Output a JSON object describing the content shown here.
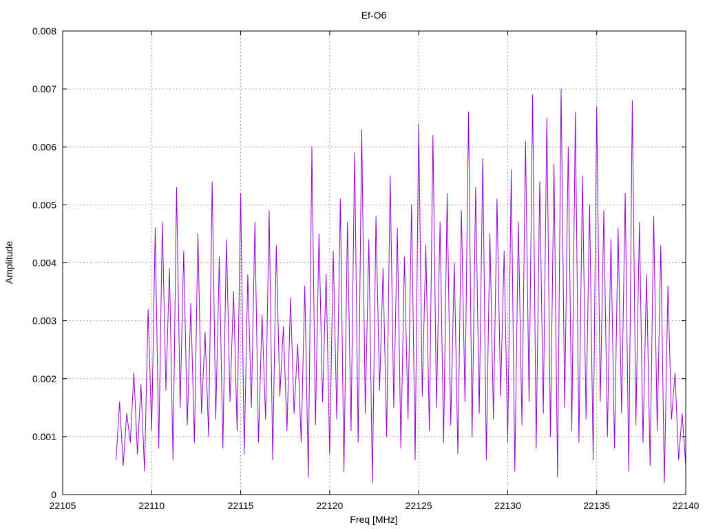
{
  "chart_data": {
    "type": "line",
    "title": "Ef-O6",
    "xlabel": "Freq [MHz]",
    "ylabel": "Amplitude",
    "xlim": [
      22105,
      22140
    ],
    "ylim": [
      0,
      0.008
    ],
    "x_ticks": [
      "22105",
      "22110",
      "22115",
      "22120",
      "22125",
      "22130",
      "22135",
      "22140"
    ],
    "y_ticks": [
      "0",
      "0.001",
      "0.002",
      "0.003",
      "0.004",
      "0.005",
      "0.006",
      "0.007",
      "0.008"
    ],
    "grid": true,
    "legend": "none",
    "series_color": "#9400d3",
    "series": [
      {
        "x": [
          22108.0,
          22108.2,
          22108.4,
          22108.6,
          22108.8,
          22109.0,
          22109.2,
          22109.4,
          22109.6,
          22109.8,
          22110.0,
          22110.2,
          22110.4,
          22110.6,
          22110.8,
          22111.0,
          22111.2,
          22111.4,
          22111.6,
          22111.8,
          22112.0,
          22112.2,
          22112.4,
          22112.6,
          22112.8,
          22113.0,
          22113.2,
          22113.4,
          22113.6,
          22113.8,
          22114.0,
          22114.2,
          22114.4,
          22114.6,
          22114.8,
          22115.0,
          22115.2,
          22115.4,
          22115.6,
          22115.8,
          22116.0,
          22116.2,
          22116.4,
          22116.6,
          22116.8,
          22117.0,
          22117.2,
          22117.4,
          22117.6,
          22117.8,
          22118.0,
          22118.2,
          22118.4,
          22118.6,
          22118.8,
          22119.0,
          22119.2,
          22119.4,
          22119.6,
          22119.8,
          22120.0,
          22120.2,
          22120.4,
          22120.6,
          22120.8,
          22121.0,
          22121.2,
          22121.4,
          22121.6,
          22121.8,
          22122.0,
          22122.2,
          22122.4,
          22122.6,
          22122.8,
          22123.0,
          22123.2,
          22123.4,
          22123.6,
          22123.8,
          22124.0,
          22124.2,
          22124.4,
          22124.6,
          22124.8,
          22125.0,
          22125.2,
          22125.4,
          22125.6,
          22125.8,
          22126.0,
          22126.2,
          22126.4,
          22126.6,
          22126.8,
          22127.0,
          22127.2,
          22127.4,
          22127.6,
          22127.8,
          22128.0,
          22128.2,
          22128.4,
          22128.6,
          22128.8,
          22129.0,
          22129.2,
          22129.4,
          22129.6,
          22129.8,
          22130.0,
          22130.2,
          22130.4,
          22130.6,
          22130.8,
          22131.0,
          22131.2,
          22131.4,
          22131.6,
          22131.8,
          22132.0,
          22132.2,
          22132.4,
          22132.6,
          22132.8,
          22133.0,
          22133.2,
          22133.4,
          22133.6,
          22133.8,
          22134.0,
          22134.2,
          22134.4,
          22134.6,
          22134.8,
          22135.0,
          22135.2,
          22135.4,
          22135.6,
          22135.8,
          22136.0,
          22136.2,
          22136.4,
          22136.6,
          22136.8,
          22137.0,
          22137.2,
          22137.4,
          22137.6,
          22137.8,
          22138.0,
          22138.2,
          22138.4,
          22138.6,
          22138.8,
          22139.0,
          22139.2,
          22139.4,
          22139.6,
          22139.8,
          22140.0
        ],
        "y": [
          0.0006,
          0.0016,
          0.0005,
          0.0014,
          0.0009,
          0.0021,
          0.0007,
          0.0019,
          0.0004,
          0.0032,
          0.0011,
          0.0046,
          0.0008,
          0.0047,
          0.0018,
          0.0039,
          0.0006,
          0.0053,
          0.0015,
          0.0042,
          0.0012,
          0.0033,
          0.0009,
          0.0045,
          0.0014,
          0.0028,
          0.001,
          0.0054,
          0.0013,
          0.0041,
          0.0008,
          0.0044,
          0.0016,
          0.0035,
          0.0011,
          0.0052,
          0.0007,
          0.0038,
          0.0015,
          0.0047,
          0.0009,
          0.0031,
          0.0013,
          0.0049,
          0.0006,
          0.0043,
          0.0017,
          0.0029,
          0.0011,
          0.0034,
          0.0014,
          0.0026,
          0.0009,
          0.0036,
          0.0003,
          0.006,
          0.0012,
          0.0045,
          0.0016,
          0.0038,
          0.0007,
          0.0042,
          0.0013,
          0.0051,
          0.0004,
          0.0047,
          0.0011,
          0.0059,
          0.0009,
          0.0063,
          0.0014,
          0.0044,
          0.0002,
          0.0048,
          0.0018,
          0.0039,
          0.001,
          0.0055,
          0.0015,
          0.0046,
          0.0008,
          0.0041,
          0.0013,
          0.005,
          0.0006,
          0.0064,
          0.0017,
          0.0043,
          0.0011,
          0.0062,
          0.0015,
          0.0047,
          0.0009,
          0.0052,
          0.0012,
          0.004,
          0.0007,
          0.0049,
          0.0016,
          0.0066,
          0.001,
          0.0053,
          0.0014,
          0.0058,
          0.0006,
          0.0045,
          0.0013,
          0.0051,
          0.0017,
          0.0042,
          0.0009,
          0.0056,
          0.0004,
          0.0047,
          0.0012,
          0.0061,
          0.0016,
          0.0069,
          0.0008,
          0.0054,
          0.0014,
          0.0065,
          0.001,
          0.0057,
          0.0003,
          0.007,
          0.0015,
          0.006,
          0.0011,
          0.0066,
          0.0009,
          0.0055,
          0.0013,
          0.005,
          0.0006,
          0.0067,
          0.0016,
          0.0049,
          0.001,
          0.0044,
          0.0008,
          0.0046,
          0.0014,
          0.0052,
          0.0004,
          0.0068,
          0.0012,
          0.0047,
          0.0009,
          0.0038,
          0.0005,
          0.0048,
          0.0011,
          0.0043,
          0.0002,
          0.0036,
          0.0013,
          0.0021,
          0.0006,
          0.0014,
          0.0005
        ]
      }
    ]
  }
}
